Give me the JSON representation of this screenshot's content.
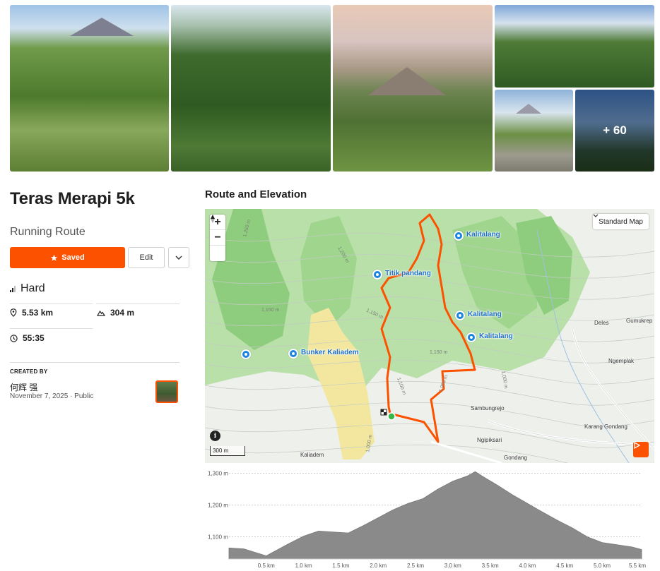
{
  "gallery": {
    "more_count": "+ 60"
  },
  "route": {
    "title": "Teras Merapi 5k",
    "type": "Running Route",
    "saved_label": "Saved",
    "edit_label": "Edit",
    "difficulty": "Hard",
    "distance": "5.53 km",
    "elevation_gain": "304 m",
    "time": "55:35"
  },
  "creator": {
    "label": "CREATED BY",
    "name": "何辉 强",
    "date": "November 7, 2025",
    "visibility": "Public"
  },
  "map_section": {
    "title": "Route and Elevation",
    "map_style_label": "Standard Map",
    "scale_label": "300 m",
    "zoom_in": "+",
    "zoom_out": "−",
    "poi": [
      {
        "label": "Kalitalang"
      },
      {
        "label": "Titik pandang"
      },
      {
        "label": "Kalitalang"
      },
      {
        "label": "Kalitalang"
      },
      {
        "label": "Bunker Kaliadem"
      }
    ],
    "places": [
      {
        "label": "Deles"
      },
      {
        "label": "Gumukrep"
      },
      {
        "label": "Ngemplak"
      },
      {
        "label": "Sambungrejo"
      },
      {
        "label": "Ngipiksari"
      },
      {
        "label": "Karang Gondang"
      },
      {
        "label": "Gondang"
      },
      {
        "label": "Kaliadem"
      }
    ],
    "contour_labels": [
      "1,250 m",
      "1,200 m",
      "1,150 m",
      "1,150 m",
      "1,100 m",
      "1,050 m",
      "1,000 m",
      "1,000 m",
      "1,150 m"
    ],
    "colors": {
      "accent": "#fc5200",
      "route": "#fc5200",
      "poi": "#1c84e0",
      "forest": "#a8d89a",
      "sand": "#f3e7a0"
    }
  },
  "chart_data": {
    "type": "area",
    "x": [
      0.0,
      0.2,
      0.5,
      0.8,
      1.0,
      1.2,
      1.4,
      1.6,
      1.8,
      2.0,
      2.2,
      2.4,
      2.6,
      2.8,
      3.0,
      3.2,
      3.3,
      3.4,
      3.6,
      3.8,
      4.0,
      4.2,
      4.4,
      4.6,
      4.8,
      5.0,
      5.2,
      5.4,
      5.53
    ],
    "y": [
      1065,
      1062,
      1040,
      1078,
      1102,
      1118,
      1115,
      1112,
      1135,
      1160,
      1185,
      1205,
      1220,
      1250,
      1275,
      1292,
      1305,
      1290,
      1262,
      1232,
      1205,
      1178,
      1152,
      1128,
      1100,
      1082,
      1075,
      1068,
      1060
    ],
    "xticks": [
      "0.5 km",
      "1.0 km",
      "1.5 km",
      "2.0 km",
      "2.5 km",
      "3.0 km",
      "3.5 km",
      "4.0 km",
      "4.5 km",
      "5.0 km",
      "5.5 km"
    ],
    "xtick_values": [
      0.5,
      1.0,
      1.5,
      2.0,
      2.5,
      3.0,
      3.5,
      4.0,
      4.5,
      5.0,
      5.5
    ],
    "yticks": [
      "1,100 m",
      "1,200 m",
      "1,300 m"
    ],
    "ytick_values": [
      1100,
      1200,
      1300
    ],
    "xlim": [
      0,
      5.53
    ],
    "ylim": [
      1030,
      1310
    ],
    "grid": true,
    "fill_color": "#8a8a8a"
  }
}
